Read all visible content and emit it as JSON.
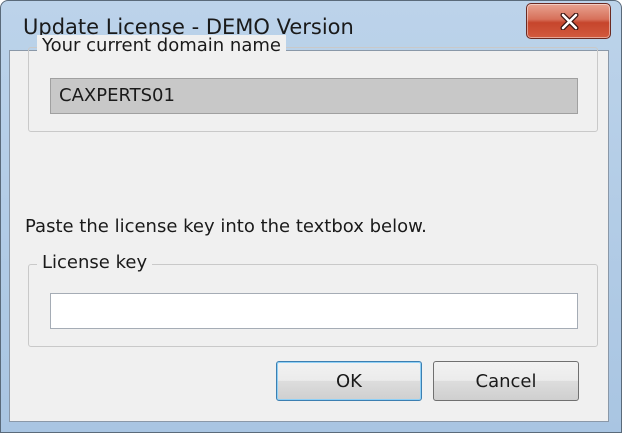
{
  "window": {
    "title": "Update License - DEMO Version",
    "close_icon": "close-icon"
  },
  "domain_group": {
    "legend": "Your current domain name",
    "value": "CAXPERTS01"
  },
  "instruction": "Paste the license key into the textbox below.",
  "license_group": {
    "legend": "License key",
    "value": ""
  },
  "buttons": {
    "ok_label": "OK",
    "cancel_label": "Cancel"
  },
  "colors": {
    "title_bar": "#bcd3ea",
    "close_button": "#c6452c",
    "dialog_face": "#f0f0f0"
  }
}
